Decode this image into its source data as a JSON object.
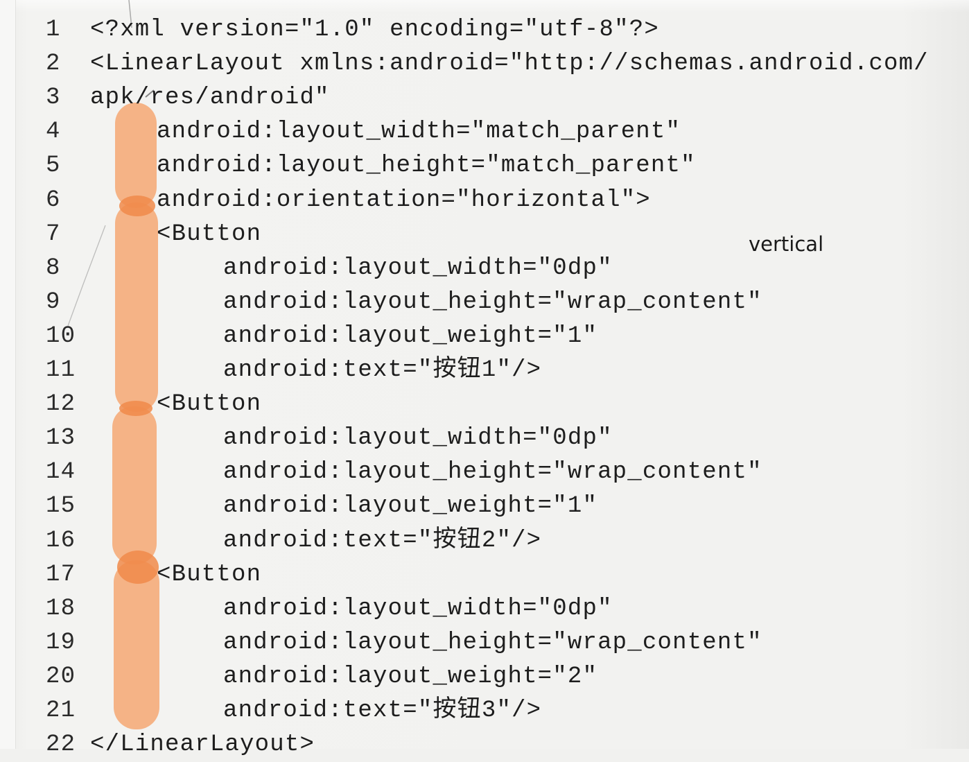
{
  "code": {
    "lines": [
      {
        "num": "1",
        "indent": 0,
        "text": "<?xml version=\"1.0\" encoding=\"utf-8\"?>"
      },
      {
        "num": "2",
        "indent": 0,
        "text": "<LinearLayout xmlns:android=\"http://schemas.android.com/"
      },
      {
        "num": "3",
        "indent": 0,
        "text": "apk/res/android\""
      },
      {
        "num": "4",
        "indent": 1,
        "text": "android:layout_width=\"match_parent\""
      },
      {
        "num": "5",
        "indent": 1,
        "text": "android:layout_height=\"match_parent\""
      },
      {
        "num": "6",
        "indent": 1,
        "text": "android:orientation=\"horizontal\">"
      },
      {
        "num": "7",
        "indent": 1,
        "text": "<Button"
      },
      {
        "num": "8",
        "indent": 2,
        "text": "android:layout_width=\"0dp\""
      },
      {
        "num": "9",
        "indent": 2,
        "text": "android:layout_height=\"wrap_content\""
      },
      {
        "num": "10",
        "indent": 2,
        "text": "android:layout_weight=\"1\""
      },
      {
        "num": "11",
        "indent": 2,
        "text": "android:text=\"按钮1\"/>"
      },
      {
        "num": "12",
        "indent": 1,
        "text": "<Button"
      },
      {
        "num": "13",
        "indent": 2,
        "text": "android:layout_width=\"0dp\""
      },
      {
        "num": "14",
        "indent": 2,
        "text": "android:layout_height=\"wrap_content\""
      },
      {
        "num": "15",
        "indent": 2,
        "text": "android:layout_weight=\"1\""
      },
      {
        "num": "16",
        "indent": 2,
        "text": "android:text=\"按钮2\"/>"
      },
      {
        "num": "17",
        "indent": 1,
        "text": "<Button"
      },
      {
        "num": "18",
        "indent": 2,
        "text": "android:layout_width=\"0dp\""
      },
      {
        "num": "19",
        "indent": 2,
        "text": "android:layout_height=\"wrap_content\""
      },
      {
        "num": "20",
        "indent": 2,
        "text": "android:layout_weight=\"2\""
      },
      {
        "num": "21",
        "indent": 2,
        "text": "android:text=\"按钮3\"/>"
      },
      {
        "num": "22",
        "indent": 0,
        "text": "</LinearLayout>"
      }
    ]
  },
  "annotation": {
    "note_text": "vertical"
  },
  "colors": {
    "highlight": "#f5a068",
    "highlight_dot": "#f08a4a",
    "paper": "#f1f1ef",
    "ink": "#1d1d1d"
  }
}
